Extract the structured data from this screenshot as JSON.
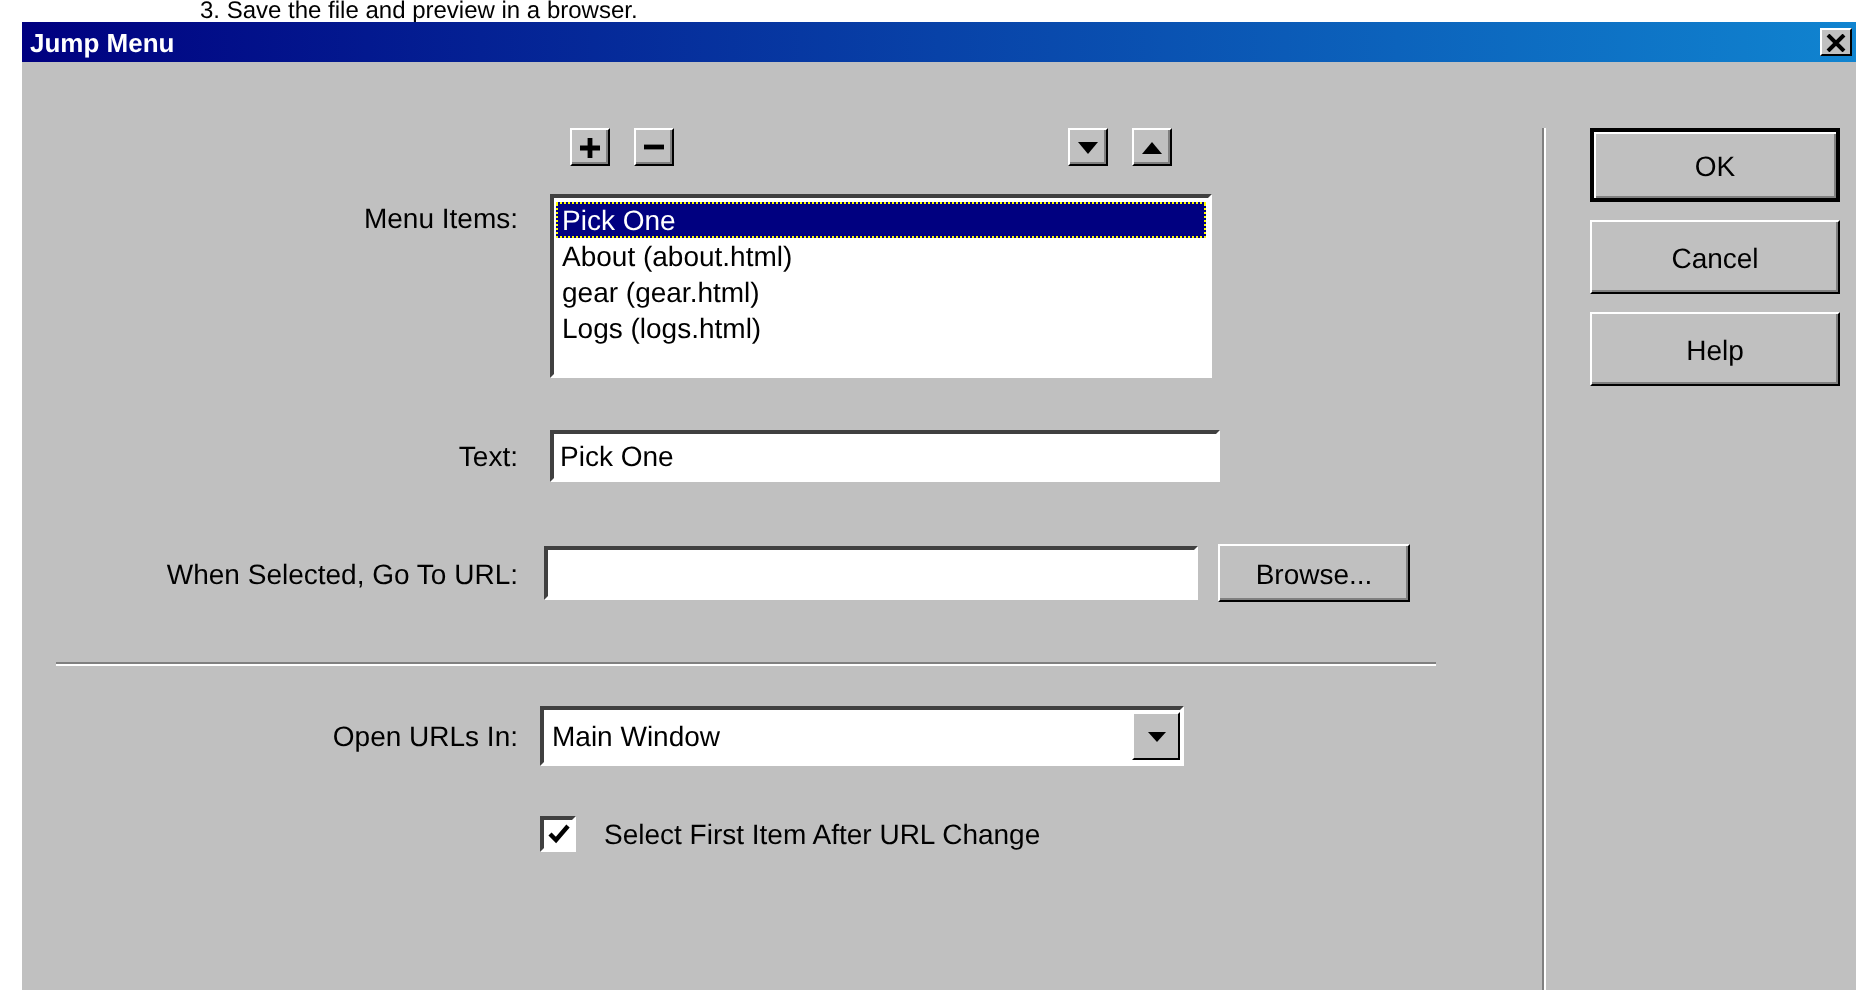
{
  "document": {
    "step_text": "3.   Save the file and preview in a browser."
  },
  "window": {
    "title": "Jump Menu"
  },
  "menu_items": {
    "label": "Menu Items:",
    "items": [
      {
        "text": "Pick One",
        "selected": true
      },
      {
        "text": "About (about.html)",
        "selected": false
      },
      {
        "text": "gear (gear.html)",
        "selected": false
      },
      {
        "text": "Logs (logs.html)",
        "selected": false
      }
    ]
  },
  "text_field": {
    "label": "Text:",
    "value": "Pick One"
  },
  "url_field": {
    "label": "When Selected, Go To URL:"
  },
  "browse_button": "Browse...",
  "open_in": {
    "label": "Open URLs In:",
    "value": "Main Window"
  },
  "select_first": {
    "label": "Select First Item After URL Change",
    "checked": true
  },
  "buttons": [
    {
      "label": "OK",
      "default": true
    },
    {
      "label": "Cancel",
      "default": false
    },
    {
      "label": "Help",
      "default": false
    }
  ]
}
